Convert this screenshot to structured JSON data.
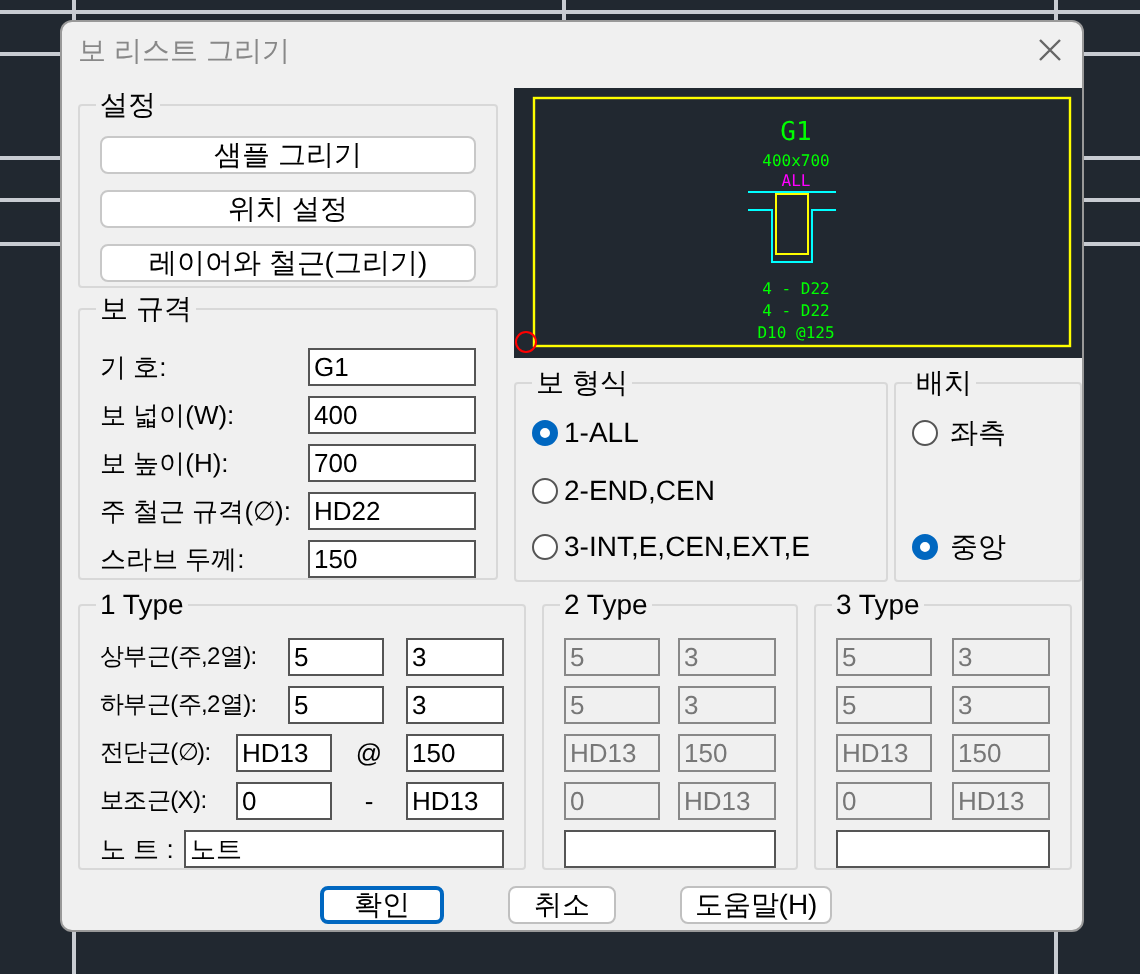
{
  "window": {
    "title": "보 리스트 그리기"
  },
  "settings": {
    "title": "설정",
    "buttons": [
      "샘플 그리기",
      "위치 설정",
      "레이어와 철근(그리기)"
    ]
  },
  "preview": {
    "title": "G1",
    "size": "400x700",
    "type": "ALL",
    "lines": [
      "4 - D22",
      "4 - D22",
      "D10 @125"
    ]
  },
  "spec": {
    "title": "보 규격",
    "fields": [
      {
        "label": "기 호:",
        "value": "G1"
      },
      {
        "label": "보 넓이(W):",
        "value": "400"
      },
      {
        "label": "보 높이(H):",
        "value": "700"
      },
      {
        "label": "주 철근 규격(∅):",
        "value": "HD22"
      },
      {
        "label": "스라브 두께:",
        "value": "150"
      }
    ]
  },
  "beam_type": {
    "title": "보 형식",
    "options": [
      {
        "label": "1-ALL",
        "selected": true
      },
      {
        "label": "2-END,CEN",
        "selected": false
      },
      {
        "label": "3-INT,E,CEN,EXT,E",
        "selected": false
      }
    ]
  },
  "placement": {
    "title": "배치",
    "options": [
      {
        "label": "좌측",
        "selected": false
      },
      {
        "label": "중앙",
        "selected": true
      }
    ]
  },
  "types": [
    {
      "title": "1 Type",
      "disabled": false,
      "rows": [
        {
          "label": "상부근(주,2열):",
          "values": [
            "5",
            "3"
          ]
        },
        {
          "label": "하부근(주,2열):",
          "values": [
            "5",
            "3"
          ]
        },
        {
          "label": "전단근(∅):",
          "values": [
            "HD13",
            "150"
          ],
          "separator": "@"
        },
        {
          "label": "보조근(X):",
          "values": [
            "0",
            "HD13"
          ],
          "separator": "-"
        }
      ],
      "note": {
        "label": "노 트 :",
        "value": "노트"
      }
    },
    {
      "title": "2 Type",
      "disabled": true,
      "rows": [
        {
          "values": [
            "5",
            "3"
          ]
        },
        {
          "values": [
            "5",
            "3"
          ]
        },
        {
          "values": [
            "HD13",
            "150"
          ]
        },
        {
          "values": [
            "0",
            "HD13"
          ]
        }
      ]
    },
    {
      "title": "3 Type",
      "disabled": true,
      "rows": [
        {
          "values": [
            "5",
            "3"
          ]
        },
        {
          "values": [
            "5",
            "3"
          ]
        },
        {
          "values": [
            "HD13",
            "150"
          ]
        },
        {
          "values": [
            "0",
            "HD13"
          ]
        }
      ]
    }
  ],
  "buttons": [
    {
      "label": "확인",
      "default": true
    },
    {
      "label": "취소",
      "default": false
    },
    {
      "label": "도움말(H)",
      "default": false
    }
  ]
}
